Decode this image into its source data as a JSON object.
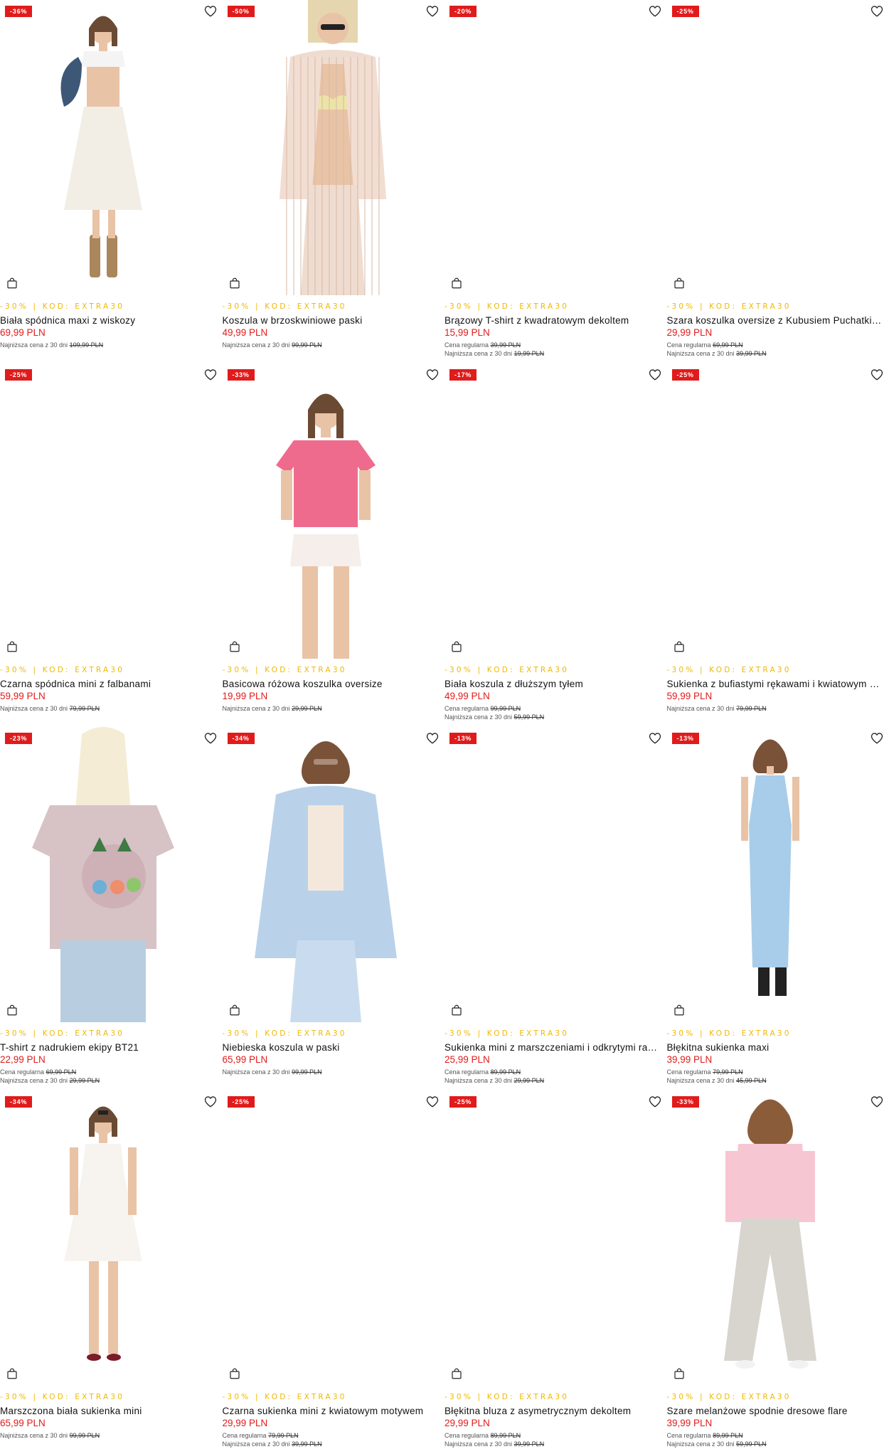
{
  "labels": {
    "regular_price": "Cena regularna",
    "lowest_price_30d": "Najniższa cena z 30 dni"
  },
  "colors": {
    "discount_badge": "#e01b1b",
    "promo_code": "#f0b800",
    "price": "#e01b1b"
  },
  "products": [
    {
      "discount": "-36%",
      "promo": "-30% | KOD: EXTRA30",
      "name": "Biała spódnica maxi z wiskozy",
      "price": "69,99 PLN",
      "regular": "",
      "lowest": "109,99 PLN",
      "photo": "white-maxi-skirt"
    },
    {
      "discount": "-50%",
      "promo": "-30% | KOD: EXTRA30",
      "name": "Koszula w brzoskwiniowe paski",
      "price": "49,99 PLN",
      "regular": "",
      "lowest": "99,99 PLN",
      "photo": "striped-shirt"
    },
    {
      "discount": "-20%",
      "promo": "-30% | KOD: EXTRA30",
      "name": "Brązowy T-shirt z kwadratowym dekoltem",
      "price": "15,99 PLN",
      "regular": "39,99 PLN",
      "lowest": "19,99 PLN",
      "photo": ""
    },
    {
      "discount": "-25%",
      "promo": "-30% | KOD: EXTRA30",
      "name": "Szara koszulka oversize z Kubusiem Puchatkiem",
      "price": "29,99 PLN",
      "regular": "69,99 PLN",
      "lowest": "39,99 PLN",
      "photo": ""
    },
    {
      "discount": "-25%",
      "promo": "-30% | KOD: EXTRA30",
      "name": "Czarna spódnica mini z falbanami",
      "price": "59,99 PLN",
      "regular": "",
      "lowest": "79,99 PLN",
      "photo": ""
    },
    {
      "discount": "-33%",
      "promo": "-30% | KOD: EXTRA30",
      "name": "Basicowa różowa koszulka oversize",
      "price": "19,99 PLN",
      "regular": "",
      "lowest": "29,99 PLN",
      "photo": "pink-tshirt"
    },
    {
      "discount": "-17%",
      "promo": "-30% | KOD: EXTRA30",
      "name": "Biała koszula z dłuższym tyłem",
      "price": "49,99 PLN",
      "regular": "99,99 PLN",
      "lowest": "59,99 PLN",
      "photo": ""
    },
    {
      "discount": "-25%",
      "promo": "-30% | KOD: EXTRA30",
      "name": "Sukienka z bufiastymi rękawami i kwiatowym nadrukiem",
      "price": "59,99 PLN",
      "regular": "",
      "lowest": "79,99 PLN",
      "photo": ""
    },
    {
      "discount": "-23%",
      "promo": "-30% | KOD: EXTRA30",
      "name": "T-shirt z nadrukiem ekipy BT21",
      "price": "22,99 PLN",
      "regular": "69,99 PLN",
      "lowest": "29,99 PLN",
      "photo": "bt21-tshirt"
    },
    {
      "discount": "-34%",
      "promo": "-30% | KOD: EXTRA30",
      "name": "Niebieska koszula w paski",
      "price": "65,99 PLN",
      "regular": "",
      "lowest": "99,99 PLN",
      "photo": "blue-shirt"
    },
    {
      "discount": "-13%",
      "promo": "-30% | KOD: EXTRA30",
      "name": "Sukienka mini z marszczeniami i odkrytymi ramionami",
      "price": "25,99 PLN",
      "regular": "89,99 PLN",
      "lowest": "29,99 PLN",
      "photo": ""
    },
    {
      "discount": "-13%",
      "promo": "-30% | KOD: EXTRA30",
      "name": "Błękitna sukienka maxi",
      "price": "39,99 PLN",
      "regular": "79,99 PLN",
      "lowest": "45,99 PLN",
      "photo": "blue-maxi-dress"
    },
    {
      "discount": "-34%",
      "promo": "-30% | KOD: EXTRA30",
      "name": "Marszczona biała sukienka mini",
      "price": "65,99 PLN",
      "regular": "",
      "lowest": "99,99 PLN",
      "photo": "white-mini-dress"
    },
    {
      "discount": "-25%",
      "promo": "-30% | KOD: EXTRA30",
      "name": "Czarna sukienka mini z kwiatowym motywem",
      "price": "29,99 PLN",
      "regular": "79,99 PLN",
      "lowest": "39,99 PLN",
      "photo": ""
    },
    {
      "discount": "-25%",
      "promo": "-30% | KOD: EXTRA30",
      "name": "Błękitna bluza z asymetrycznym dekoltem",
      "price": "29,99 PLN",
      "regular": "89,99 PLN",
      "lowest": "39,99 PLN",
      "photo": ""
    },
    {
      "discount": "-33%",
      "promo": "-30% | KOD: EXTRA30",
      "name": "Szare melanżowe spodnie dresowe flare",
      "price": "39,99 PLN",
      "regular": "89,99 PLN",
      "lowest": "59,99 PLN",
      "photo": "grey-flare-pants"
    }
  ]
}
